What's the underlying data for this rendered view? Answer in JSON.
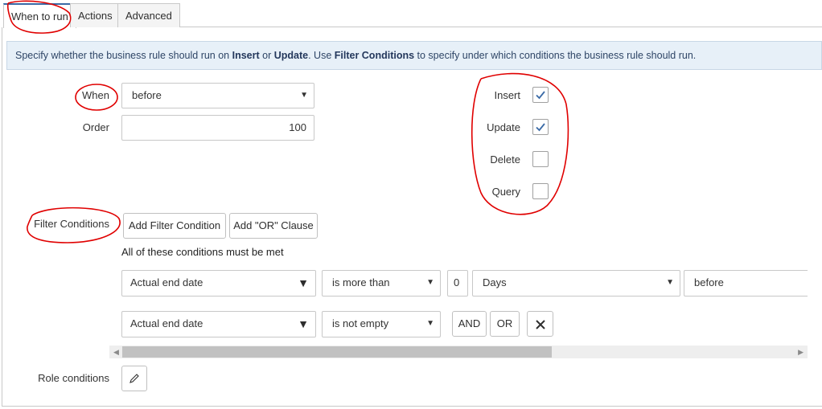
{
  "tabs": [
    {
      "label": "When to run",
      "active": true
    },
    {
      "label": "Actions",
      "active": false
    },
    {
      "label": "Advanced",
      "active": false
    }
  ],
  "info": {
    "part1": "Specify whether the business rule should run on ",
    "insert": "Insert",
    "or": " or ",
    "update": "Update",
    "part2": ". Use ",
    "filter": "Filter Conditions",
    "part3": " to specify under which conditions the business rule should run."
  },
  "when": {
    "label": "When",
    "value": "before"
  },
  "order": {
    "label": "Order",
    "value": "100"
  },
  "operations": [
    {
      "label": "Insert",
      "checked": true
    },
    {
      "label": "Update",
      "checked": true
    },
    {
      "label": "Delete",
      "checked": false
    },
    {
      "label": "Query",
      "checked": false
    }
  ],
  "filter": {
    "label": "Filter Conditions",
    "add_condition": "Add Filter Condition",
    "add_or": "Add \"OR\" Clause",
    "must_be_met": "All of these conditions must be met",
    "rows": [
      {
        "field": "Actual end date",
        "operator": "is more than",
        "number": "0",
        "unit": "Days",
        "relation": "before"
      },
      {
        "field": "Actual end date",
        "operator": "is not empty",
        "and": "AND",
        "or": "OR"
      }
    ]
  },
  "role_conditions": {
    "label": "Role conditions"
  },
  "colors": {
    "accent": "#3a6aa6",
    "annotation": "#e00000",
    "info_bg": "#e7f0f8"
  }
}
